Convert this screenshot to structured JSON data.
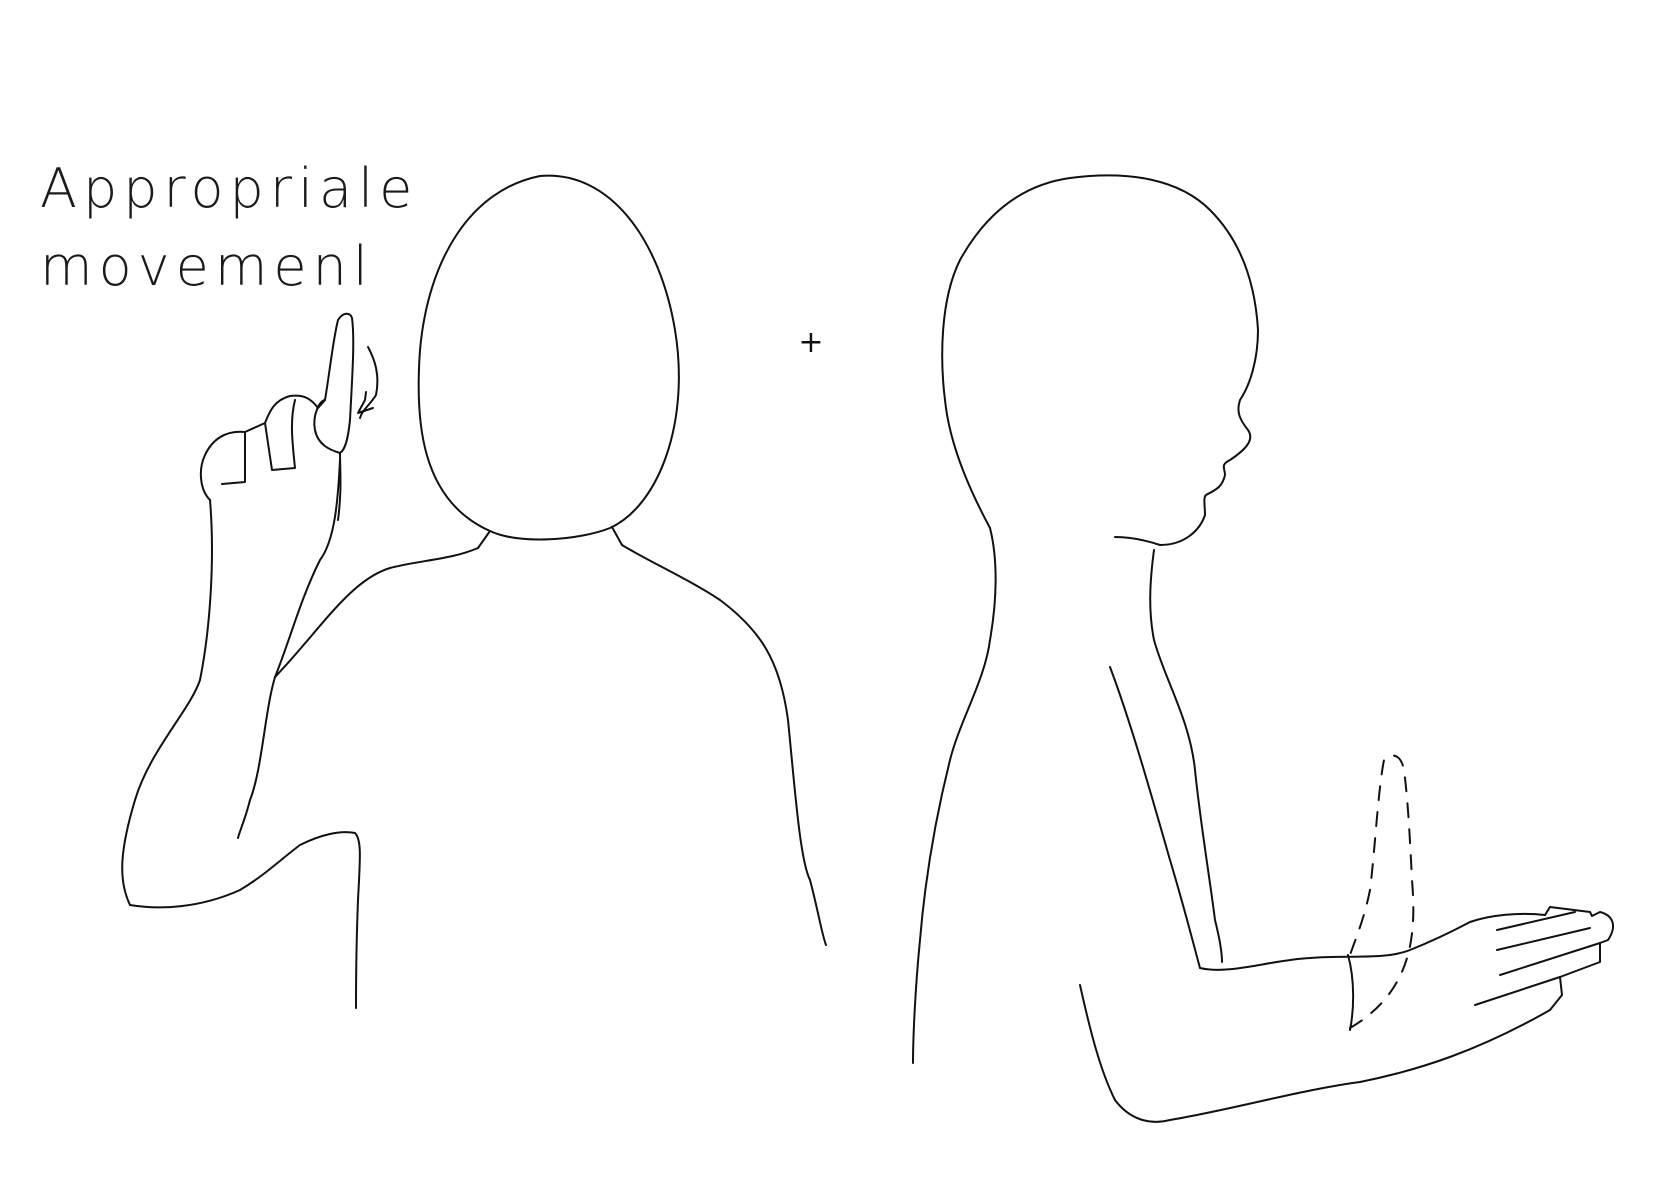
{
  "caption": {
    "line1": "Appropriale",
    "line2": "movemenl"
  },
  "plus_sign": "+",
  "colors": {
    "background": "#ffffff",
    "stroke": "#111111"
  }
}
